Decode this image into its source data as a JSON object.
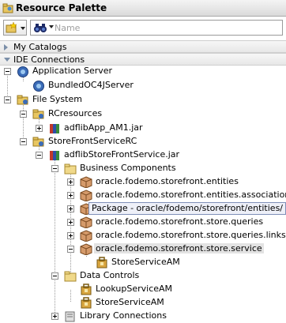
{
  "window": {
    "title": "Resource Palette"
  },
  "toolbar": {
    "search_placeholder": "Name"
  },
  "sections": {
    "my_catalogs": "My Catalogs",
    "ide_connections": "IDE Connections"
  },
  "tree": {
    "application_server": "Application Server",
    "bundled_server": "BundledOC4JServer",
    "file_system": "File System",
    "rcresources": "RCresources",
    "adflib_app": "adflibApp_AM1.jar",
    "storefront_rc": "StoreFrontServiceRC",
    "adflib_storefront": "adflibStoreFrontService.jar",
    "business_components": "Business Components",
    "entities": "oracle.fodemo.storefront.entities",
    "associations": "oracle.fodemo.storefront.entities.associations",
    "store_queries": "oracle.fodemo.storefront.store.queries",
    "queries_links": "oracle.fodemo.storefront.store.queries.links",
    "store_service": "oracle.fodemo.storefront.store.service",
    "store_service_am": "StoreServiceAM",
    "data_controls": "Data Controls",
    "lookup_am": "LookupServiceAM",
    "store_am": "StoreServiceAM",
    "library_connections": "Library Connections"
  },
  "tooltip": {
    "text": "Package - oracle/fodemo/storefront/entities/"
  },
  "colors": {
    "accent": "#7a8ea8",
    "folder": "#e8c660",
    "package": "#c9865a"
  }
}
